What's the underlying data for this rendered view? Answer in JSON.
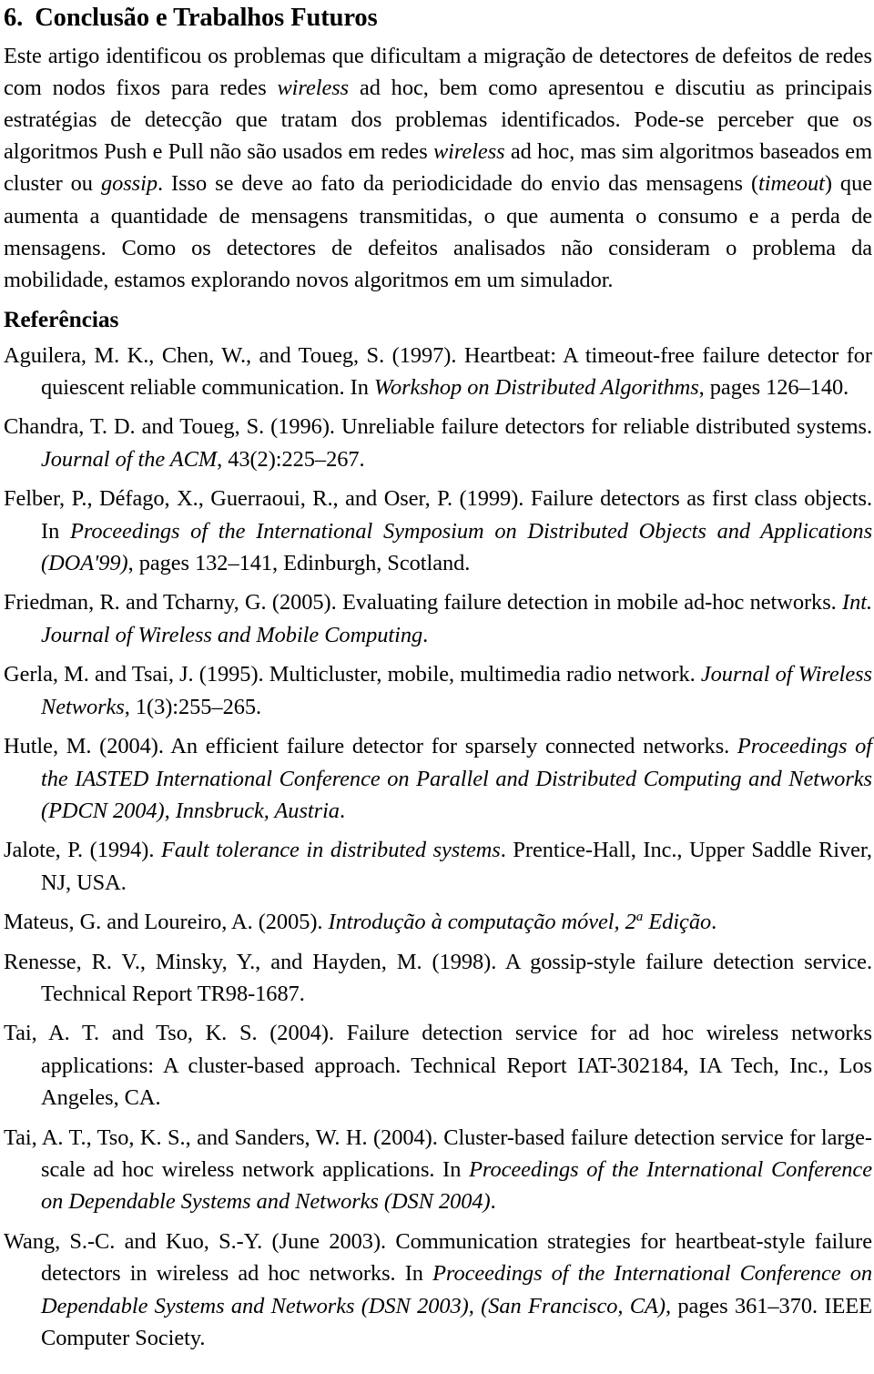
{
  "section": {
    "number": "6.",
    "title": "Conclusão e Trabalhos Futuros",
    "paragraph_parts": [
      {
        "text": "Este artigo identificou os problemas que dificultam a migração de detectores de defeitos de redes com nodos fixos para redes ",
        "style": "normal"
      },
      {
        "text": "wireless",
        "style": "italic"
      },
      {
        "text": " ad hoc, bem como apresentou e discutiu as principais estratégias de detecção que tratam dos problemas identificados.  Pode-se perceber que os algoritmos Push e Pull não são usados em redes ",
        "style": "normal"
      },
      {
        "text": "wireless",
        "style": "italic"
      },
      {
        "text": " ad hoc, mas sim algoritmos baseados em cluster ou ",
        "style": "normal"
      },
      {
        "text": "gossip",
        "style": "italic"
      },
      {
        "text": ". Isso se deve ao fato da periodicidade do envio das mensagens (",
        "style": "normal"
      },
      {
        "text": "timeout",
        "style": "italic"
      },
      {
        "text": ") que aumenta a quantidade de mensagens transmitidas, o que aumenta o consumo e a perda de mensagens.  Como os detectores de defeitos analisados não consideram o problema da mobilidade, estamos explorando novos algoritmos em um simulador.",
        "style": "normal"
      }
    ]
  },
  "references": {
    "heading": "Referências",
    "entries": [
      {
        "id": "ref-aguilera-1997",
        "parts": [
          {
            "text": "Aguilera, M. K., Chen, W., and Toueg, S. (1997).  Heartbeat: A timeout-free failure detector for quiescent reliable communication.  In ",
            "style": "normal"
          },
          {
            "text": "Workshop on Distributed Algorithms",
            "style": "italic"
          },
          {
            "text": ", pages 126–140.",
            "style": "normal"
          }
        ]
      },
      {
        "id": "ref-chandra-1996",
        "parts": [
          {
            "text": "Chandra, T. D. and Toueg, S. (1996).  Unreliable failure detectors for reliable distributed systems. ",
            "style": "normal"
          },
          {
            "text": "Journal of the ACM",
            "style": "italic"
          },
          {
            "text": ", 43(2):225–267.",
            "style": "normal"
          }
        ]
      },
      {
        "id": "ref-felber-1999",
        "parts": [
          {
            "text": "Felber, P., Défago, X., Guerraoui, R., and Oser, P. (1999).  Failure detectors as first class objects.  In ",
            "style": "normal"
          },
          {
            "text": "Proceedings of the International Symposium on Distributed Objects and Applications (DOA'99)",
            "style": "italic"
          },
          {
            "text": ", pages 132–141, Edinburgh, Scotland.",
            "style": "normal"
          }
        ]
      },
      {
        "id": "ref-friedman-2005",
        "parts": [
          {
            "text": "Friedman, R. and Tcharny, G. (2005).  Evaluating failure detection in mobile ad-hoc networks. ",
            "style": "normal"
          },
          {
            "text": "Int. Journal of Wireless and Mobile Computing",
            "style": "italic"
          },
          {
            "text": ".",
            "style": "normal"
          }
        ]
      },
      {
        "id": "ref-gerla-1995",
        "parts": [
          {
            "text": "Gerla, M. and Tsai, J. (1995).  Multicluster, mobile, multimedia radio network. ",
            "style": "normal"
          },
          {
            "text": "Journal of Wireless Networks",
            "style": "italic"
          },
          {
            "text": ", 1(3):255–265.",
            "style": "normal"
          }
        ]
      },
      {
        "id": "ref-hutle-2004",
        "parts": [
          {
            "text": "Hutle, M. (2004).  An efficient failure detector for sparsely connected networks. ",
            "style": "normal"
          },
          {
            "text": "Proceedings of the IASTED International Conference on Parallel and Distributed Computing and Networks (PDCN 2004), Innsbruck, Austria",
            "style": "italic"
          },
          {
            "text": ".",
            "style": "normal"
          }
        ]
      },
      {
        "id": "ref-jalote-1994",
        "parts": [
          {
            "text": "Jalote, P. (1994). ",
            "style": "normal"
          },
          {
            "text": "Fault tolerance in distributed systems",
            "style": "italic"
          },
          {
            "text": ". Prentice-Hall, Inc., Upper Saddle River, NJ, USA.",
            "style": "normal"
          }
        ]
      },
      {
        "id": "ref-mateus-2005",
        "parts": [
          {
            "text": "Mateus, G. and Loureiro, A. (2005). ",
            "style": "normal"
          },
          {
            "text": "Introdução à computação móvel, 2",
            "style": "italic"
          },
          {
            "text": "a",
            "style": "italic-sup"
          },
          {
            "text": " Edição",
            "style": "italic"
          },
          {
            "text": ".",
            "style": "normal"
          }
        ]
      },
      {
        "id": "ref-renesse-1998",
        "parts": [
          {
            "text": "Renesse, R. V., Minsky, Y., and Hayden, M. (1998).  A gossip-style failure detection service. Technical Report TR98-1687.",
            "style": "normal"
          }
        ]
      },
      {
        "id": "ref-tai-tso-2004",
        "parts": [
          {
            "text": "Tai, A. T. and Tso, K. S. (2004).  Failure detection service for ad hoc wireless networks applications: A cluster-based approach.  Technical Report IAT-302184, IA Tech, Inc., Los Angeles, CA.",
            "style": "normal"
          }
        ]
      },
      {
        "id": "ref-tai-sanders-2004",
        "parts": [
          {
            "text": "Tai, A. T., Tso, K. S., and Sanders, W. H. (2004). Cluster-based failure detection service for large-scale ad hoc wireless network applications.  In ",
            "style": "normal"
          },
          {
            "text": "Proceedings of the International Conference on Dependable Systems and Networks (DSN 2004)",
            "style": "italic"
          },
          {
            "text": ".",
            "style": "normal"
          }
        ]
      },
      {
        "id": "ref-wang-2003",
        "parts": [
          {
            "text": "Wang, S.-C. and Kuo, S.-Y. (June 2003).  Communication strategies for heartbeat-style failure detectors in wireless ad hoc networks.  In ",
            "style": "normal"
          },
          {
            "text": "Proceedings of the International Conference on Dependable Systems and Networks (DSN 2003), (San Francisco, CA)",
            "style": "italic"
          },
          {
            "text": ", pages 361–370. IEEE Computer Society.",
            "style": "normal"
          }
        ]
      }
    ]
  }
}
